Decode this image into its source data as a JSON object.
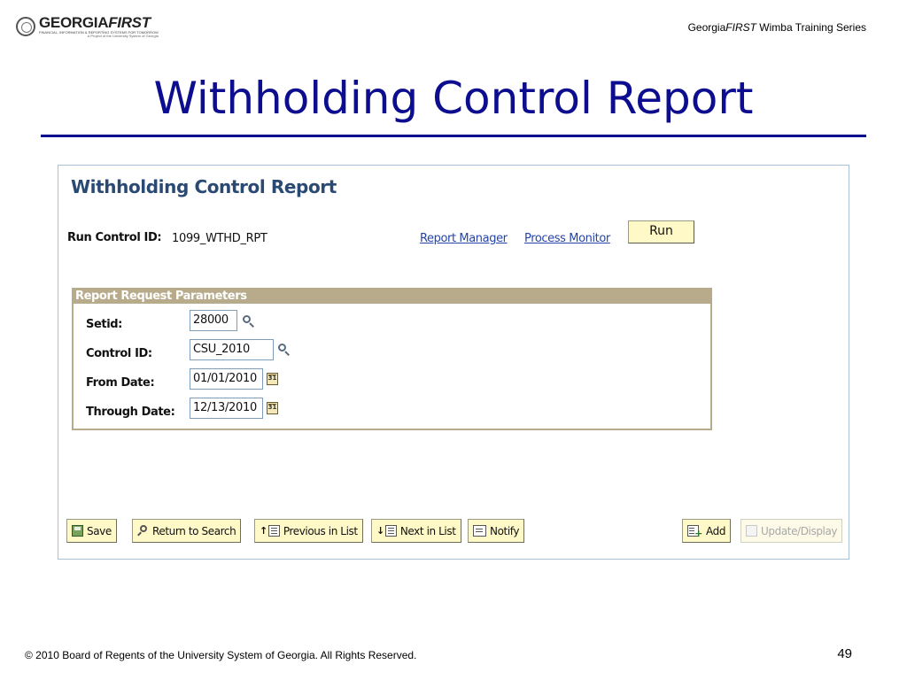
{
  "slide": {
    "logo_main_a": "GEORGIA",
    "logo_main_b": "FIRST",
    "logo_sub": "FINANCIAL, INFORMATION & REPORTING SYSTEMS FOR TOMORROW",
    "logo_sub2": "A Project of the University System of Georgia",
    "series_prefix": "Georgia",
    "series_emph": "FIRST",
    "series_suffix": " Wimba Training Series",
    "title": "Withholding Control Report",
    "footer": "© 2010 Board of Regents of the University System of Georgia.  All Rights Reserved.",
    "page_number": "49"
  },
  "screen": {
    "heading": "Withholding Control Report",
    "run_control_label": "Run Control ID:",
    "run_control_value": "1099_WTHD_RPT",
    "report_manager_link": "Report Manager",
    "process_monitor_link": "Process Monitor",
    "run_button": "Run",
    "params": {
      "header": "Report Request Parameters",
      "setid_label": "Setid:",
      "setid_value": "28000",
      "control_id_label": "Control ID:",
      "control_id_value": "CSU_2010",
      "from_date_label": "From Date:",
      "from_date_value": "01/01/2010",
      "through_date_label": "Through Date:",
      "through_date_value": "12/13/2010",
      "calendar_glyph": "31"
    },
    "toolbar": {
      "save": "Save",
      "return_to_search": "Return to Search",
      "previous_in_list": "Previous in List",
      "next_in_list": "Next in List",
      "notify": "Notify",
      "add": "Add",
      "update_display": "Update/Display",
      "up_arrow": "↑",
      "down_arrow": "↓"
    }
  },
  "colors": {
    "title": "#0d0d8f",
    "heading": "#2b4a73",
    "link": "#2544a8",
    "group_header": "#b7ab8b",
    "button_face": "#fff9c7"
  }
}
